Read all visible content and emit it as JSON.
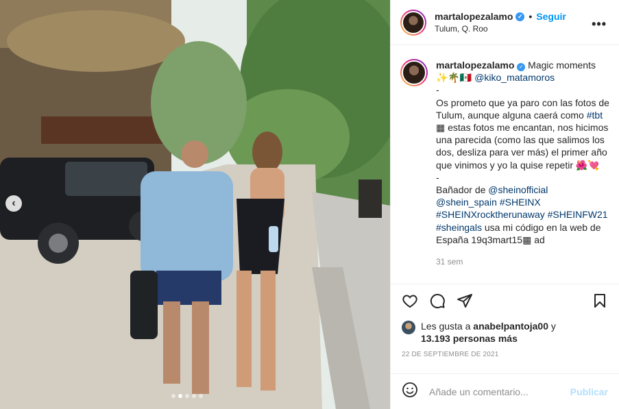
{
  "post": {
    "username": "martalopezalamo",
    "follow_label": "Seguir",
    "separator": "•",
    "location": "Tulum, Q. Roo",
    "more_label": "•••"
  },
  "caption": {
    "username": "martalopezalamo",
    "intro": "Magic moments",
    "emojis_line2": "✨🌴🇲🇽",
    "mention1": "@kiko_matamoros",
    "dash1": "-",
    "text1": "Os prometo que ya paro con las fotos de Tulum, aunque alguna caerá como",
    "tag_tbt": "#tbt",
    "text2": "▦ estas fotos me encantan, nos hicimos una parecida (como las que salimos los dos, desliza para ver más) el primer año que vinimos y yo la quise repetir 🌺💘",
    "dash2": "-",
    "text3": "Bañador de",
    "mention2": "@sheinofficial",
    "mention3": "@shein_spain",
    "tag_sheinx": "#SHEINX",
    "tag_rock": "#SHEINXrocktherunaway",
    "tag_fw21": "#SHEINFW21",
    "tag_gals": "#sheingals",
    "text4": "usa mi código en la web de España 19q3mart15▦ ad",
    "time_ago": "31 sem"
  },
  "likes": {
    "prefix": "Les gusta a",
    "user": "anabelpantoja00",
    "joiner": "y",
    "count": "13.193 personas más"
  },
  "date": "22 DE SEPTIEMBRE DE 2021",
  "comment": {
    "placeholder": "Añade un comentario...",
    "publish_label": "Publicar"
  },
  "carousel": {
    "prev_glyph": "‹",
    "total": 5,
    "active_index": 1
  },
  "colors": {
    "link_blue": "#0095f6",
    "mention": "#00376b",
    "verified": "#3897f0"
  }
}
